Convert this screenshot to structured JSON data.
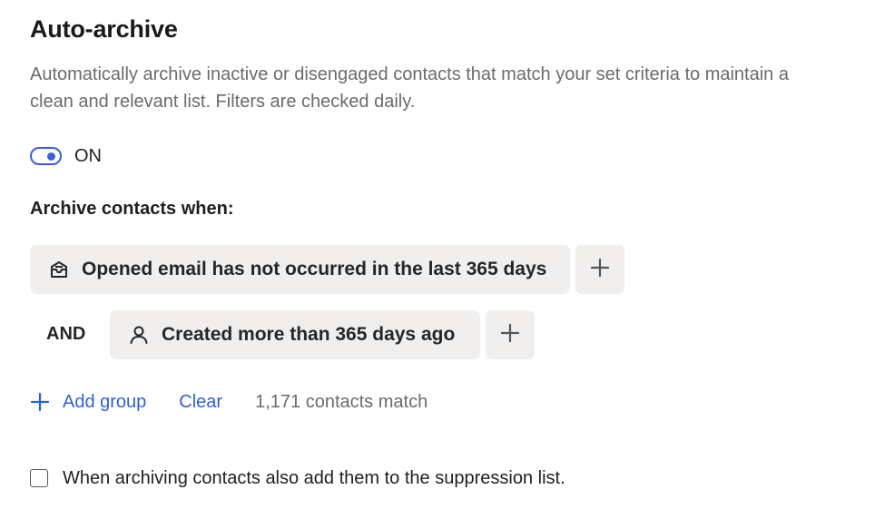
{
  "section": {
    "title": "Auto-archive",
    "description": "Automatically archive inactive or disengaged contacts that match your set criteria to maintain a clean and relevant list. Filters are checked daily."
  },
  "toggle": {
    "state_label": "ON",
    "enabled": true
  },
  "criteria": {
    "heading": "Archive contacts when:",
    "conditions": [
      {
        "icon": "email-open-icon",
        "text": "Opened email has not occurred in the last 365 days"
      },
      {
        "connector": "AND",
        "icon": "person-icon",
        "text": "Created more than 365 days ago"
      }
    ]
  },
  "actions": {
    "add_group_label": "Add group",
    "clear_label": "Clear",
    "match_count_text": "1,171 contacts match"
  },
  "suppression": {
    "checked": false,
    "label": "When archiving contacts also add them to the suppression list."
  },
  "colors": {
    "accent": "#3b5fe0",
    "link": "#2f5fd8",
    "chip_background": "#f0efee",
    "muted_text": "#6b6b6b"
  }
}
